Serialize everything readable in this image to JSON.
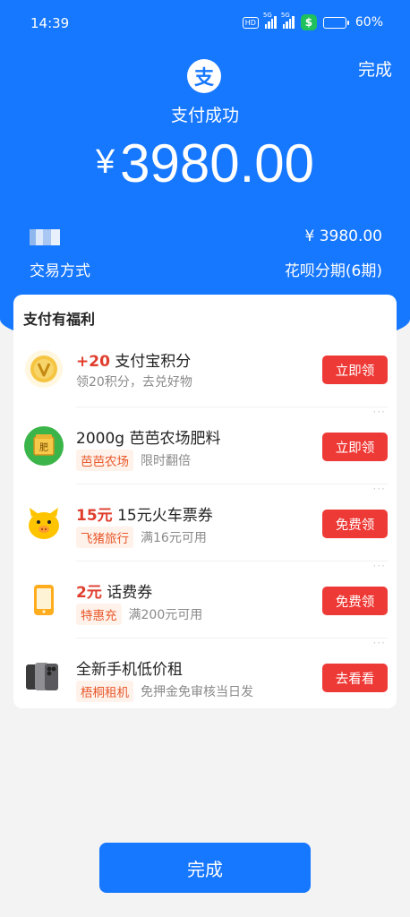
{
  "status_bar": {
    "time": "14:39",
    "network_hd": "HD",
    "net_5g": "5G",
    "battery": "60%",
    "battery_level": 0.6
  },
  "header": {
    "done_label": "完成",
    "logo_char": "支",
    "title": "支付成功",
    "currency": "¥",
    "amount": "3980.00"
  },
  "info": {
    "amount": "¥ 3980.00",
    "label": "交易方式",
    "value": "花呗分期(6期)"
  },
  "benefits": {
    "title": "支付有福利",
    "items": [
      {
        "icon": "coin-v-icon",
        "highlight": "+20",
        "title": " 支付宝积分",
        "tag": "",
        "desc": "领20积分，去兑好物",
        "button": "立即领"
      },
      {
        "icon": "fertilizer-bag-icon",
        "highlight": "",
        "title": "2000g 芭芭农场肥料",
        "tag": "芭芭农场",
        "desc": "限时翻倍",
        "button": "立即领"
      },
      {
        "icon": "fliggy-pig-icon",
        "highlight": "15元",
        "title": " 15元火车票券",
        "tag": "飞猪旅行",
        "desc": "满16元可用",
        "button": "免费领"
      },
      {
        "icon": "phone-icon",
        "highlight": "2元",
        "title": " 话费券",
        "tag": "特惠充",
        "desc": "满200元可用",
        "button": "免费领"
      },
      {
        "icon": "smartphone-product-icon",
        "highlight": "",
        "title": "全新手机低价租",
        "tag": "梧桐租机",
        "desc": "免押金免审核当日发",
        "button": "去看看"
      }
    ]
  },
  "footer": {
    "done_label": "完成"
  },
  "colors": {
    "brand_blue": "#1677ff",
    "button_red": "#ee3a36",
    "tag_orange": "#e8592b"
  }
}
